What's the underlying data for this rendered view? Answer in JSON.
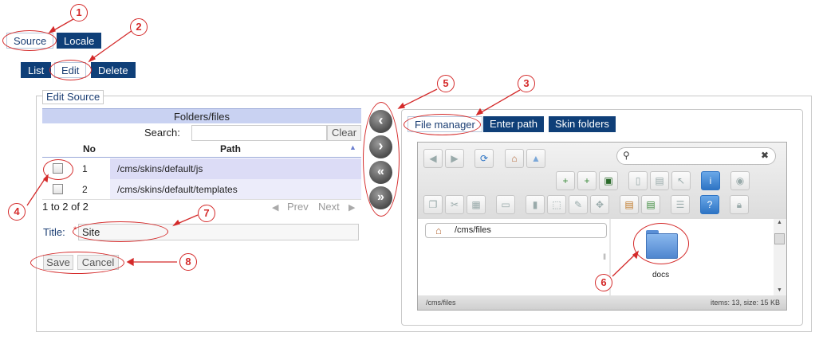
{
  "top_tabs": [
    "Source",
    "Locale"
  ],
  "action_tabs": [
    "List",
    "Edit",
    "Delete"
  ],
  "legend": "Edit Source",
  "grid": {
    "header": "Folders/files",
    "search_label": "Search:",
    "clear_label": "Clear",
    "col_no": "No",
    "col_path": "Path",
    "rows": [
      {
        "no": "1",
        "path": "/cms/skins/default/js"
      },
      {
        "no": "2",
        "path": "/cms/skins/default/templates"
      }
    ],
    "pager_info": "1 to 2 of 2",
    "prev": "Prev",
    "next": "Next"
  },
  "title_field": {
    "label": "Title:",
    "value": "Site"
  },
  "buttons": {
    "save": "Save",
    "cancel": "Cancel"
  },
  "move_arrows": [
    "chevron-left-icon",
    "chevron-right-icon",
    "double-chevron-left-icon",
    "double-chevron-right-icon"
  ],
  "right_tabs": [
    "File manager",
    "Enter path",
    "Skin folders"
  ],
  "file_manager": {
    "tree_path": "/cms/files",
    "folder_name": "docs",
    "status_path": "/cms/files",
    "status_info": "items: 13, size: 15 KB"
  },
  "callouts": [
    "1",
    "2",
    "3",
    "4",
    "5",
    "6",
    "7",
    "8"
  ],
  "colors": {
    "accent": "#0f3f78",
    "annotation": "#d42a2a",
    "grid_header": "#c9d2f2"
  }
}
